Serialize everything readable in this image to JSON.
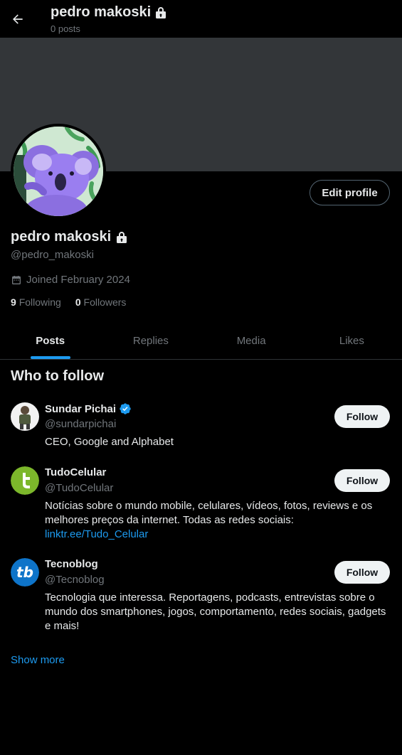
{
  "header": {
    "title": "pedro makoski",
    "post_count": "0 posts"
  },
  "profile": {
    "name": "pedro makoski",
    "handle": "@pedro_makoski",
    "joined": "Joined February 2024",
    "following_count": "9",
    "following_label": "Following",
    "followers_count": "0",
    "followers_label": "Followers",
    "edit_label": "Edit profile"
  },
  "tabs": [
    {
      "label": "Posts",
      "active": true
    },
    {
      "label": "Replies",
      "active": false
    },
    {
      "label": "Media",
      "active": false
    },
    {
      "label": "Likes",
      "active": false
    }
  ],
  "who_to_follow": {
    "title": "Who to follow",
    "items": [
      {
        "name": "Sundar Pichai",
        "handle": "@sundarpichai",
        "bio": "CEO, Google and Alphabet",
        "verified": true,
        "follow_label": "Follow"
      },
      {
        "name": "TudoCelular",
        "handle": "@TudoCelular",
        "bio": "Notícias sobre o mundo mobile, celulares, vídeos, fotos, reviews e os melhores preços da internet. Todas as redes sociais:",
        "link": "linktr.ee/Tudo_Celular",
        "follow_label": "Follow"
      },
      {
        "name": "Tecnoblog",
        "handle": "@Tecnoblog",
        "bio": "Tecnologia que interessa. Reportagens, podcasts, entrevistas sobre o mundo dos smartphones, jogos, comportamento, redes sociais, gadgets e mais!",
        "follow_label": "Follow"
      }
    ],
    "show_more": "Show more"
  },
  "icons": {
    "back": "arrow-left-icon",
    "lock": "lock-icon",
    "calendar": "calendar-icon",
    "verified": "verified-badge-icon"
  },
  "colors": {
    "accent": "#1d9bf0",
    "background": "#000000",
    "banner": "#333639",
    "text_secondary": "#71767b"
  }
}
